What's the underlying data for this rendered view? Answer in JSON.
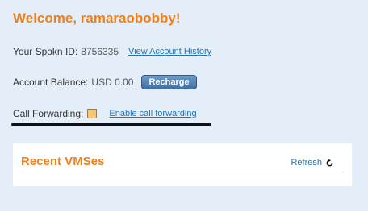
{
  "welcome": "Welcome, ramaraobobby!",
  "spokn_id": {
    "label": "Your Spokn ID:",
    "value": "8756335",
    "link": "View Account History"
  },
  "balance": {
    "label": "Account Balance:",
    "value": "USD 0.00",
    "button": "Recharge"
  },
  "call_forwarding": {
    "label": "Call Forwarding:",
    "checked": false,
    "link": "Enable call forwarding"
  },
  "recent_vms": {
    "title": "Recent VMSes",
    "refresh": "Refresh",
    "refresh_icon": "refresh-icon"
  },
  "colors": {
    "accent": "#f0801c",
    "link": "#2276b6",
    "background": "#e4eef8",
    "button": "#3e6fa6"
  }
}
